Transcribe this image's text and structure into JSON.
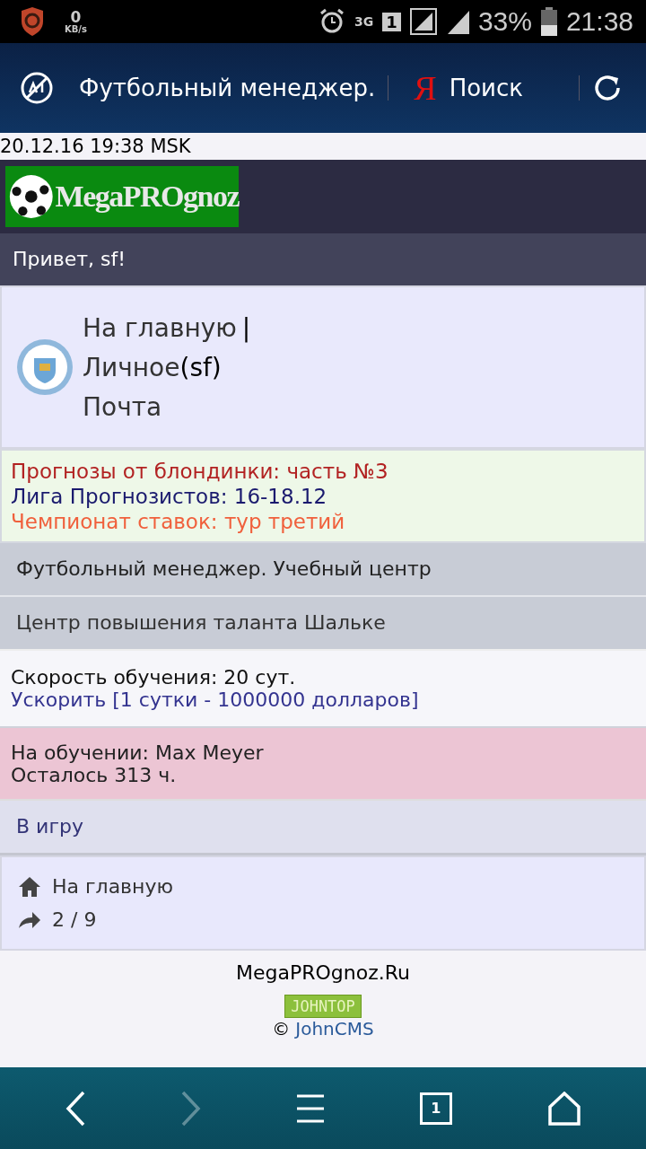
{
  "status_bar": {
    "speed_value": "0",
    "speed_unit": "KB/s",
    "network": "3G",
    "sim": "1",
    "battery": "33%",
    "time": "21:38"
  },
  "browser_bar": {
    "title": "Футбольный менеджер.",
    "search_logo": "Я",
    "search_label": "Поиск"
  },
  "datetime": "20.12.16 19:38 MSK",
  "logo": {
    "text": "MegaPROgnoz"
  },
  "greeting": "Привет, sf!",
  "user_menu": [
    {
      "label": "На главную",
      "separator": "|"
    },
    {
      "label": "Личное",
      "suffix": "(sf)"
    },
    {
      "label": "Почта"
    }
  ],
  "news": [
    {
      "text": "Прогнозы от блондинки: часть №3",
      "color": "#b22222"
    },
    {
      "text": "Лига Прогнозистов: 16-18.12",
      "color": "#1a1a6e"
    },
    {
      "text": "Чемпионат ставок: тур третий",
      "color": "#f0603c"
    }
  ],
  "page_title": "Футбольный менеджер. Учебный центр",
  "subtitle": "Центр повышения таланта Шальке",
  "speed": {
    "text": "Скорость обучения: 20 сут.",
    "link": "Ускорить [1 сутки - 1000000 долларов]"
  },
  "training": {
    "player": "На обучении: Max Meyer",
    "remaining": "Осталось 313 ч."
  },
  "play_link": "В игру",
  "footer_nav": [
    {
      "kind": "home",
      "label": "На главную"
    },
    {
      "kind": "forward",
      "label": "2 / 9"
    }
  ],
  "footer": {
    "site": "MegaPROgnoz.Ru",
    "counter": "JOHNTOP",
    "copyright": "©",
    "cms_link": "JohnCMS"
  },
  "nav_bar": {
    "back_disabled": false,
    "forward_disabled": true,
    "tab_count": "1"
  }
}
